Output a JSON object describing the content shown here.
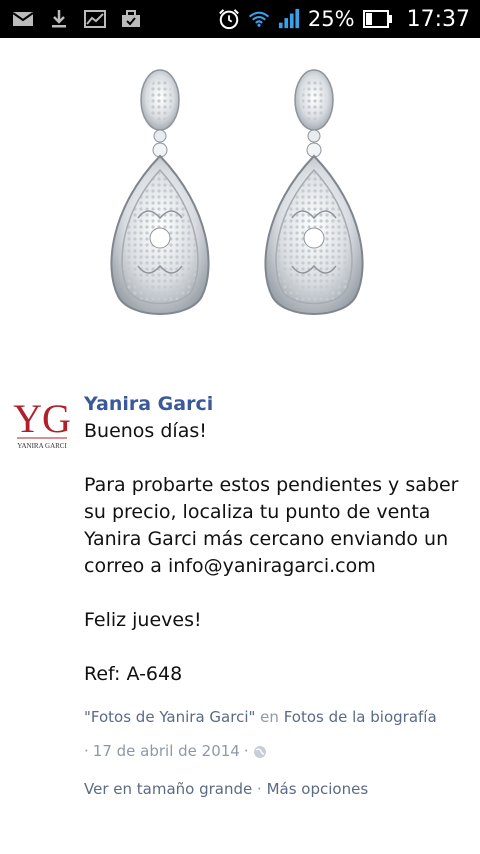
{
  "status_bar": {
    "battery_percent": "25%",
    "time": "17:37",
    "icons": [
      "mail-icon",
      "download-icon",
      "chart-icon",
      "briefcase-icon",
      "alarm-icon",
      "wifi-icon",
      "signal-icon",
      "battery-icon"
    ]
  },
  "photo": {
    "description_icon": "earrings-photo"
  },
  "post": {
    "author": "Yanira Garci",
    "avatar_text": "YG",
    "avatar_caption": "YANIRA GARCI",
    "paragraphs": [
      "Buenos días!",
      "Para probarte estos pendientes y saber su precio, localiza tu punto de venta Yanira Garci más cercano enviando un correo a info@yaniragarci.com",
      "Feliz jueves!",
      "Ref: A-648"
    ],
    "album_link": "\"Fotos de Yanira Garci\"",
    "album_connector": "en",
    "album_parent": "Fotos de la biografía",
    "date_prefix": "·",
    "date": "17 de abril de 2014",
    "date_suffix": "·",
    "view_large": "Ver en tamaño grande",
    "separator": "·",
    "more_options": "Más opciones"
  },
  "colors": {
    "author": "#3b5998",
    "meta": "#5b6b85",
    "status_bar": "#000000",
    "logo_red": "#b0202a"
  }
}
